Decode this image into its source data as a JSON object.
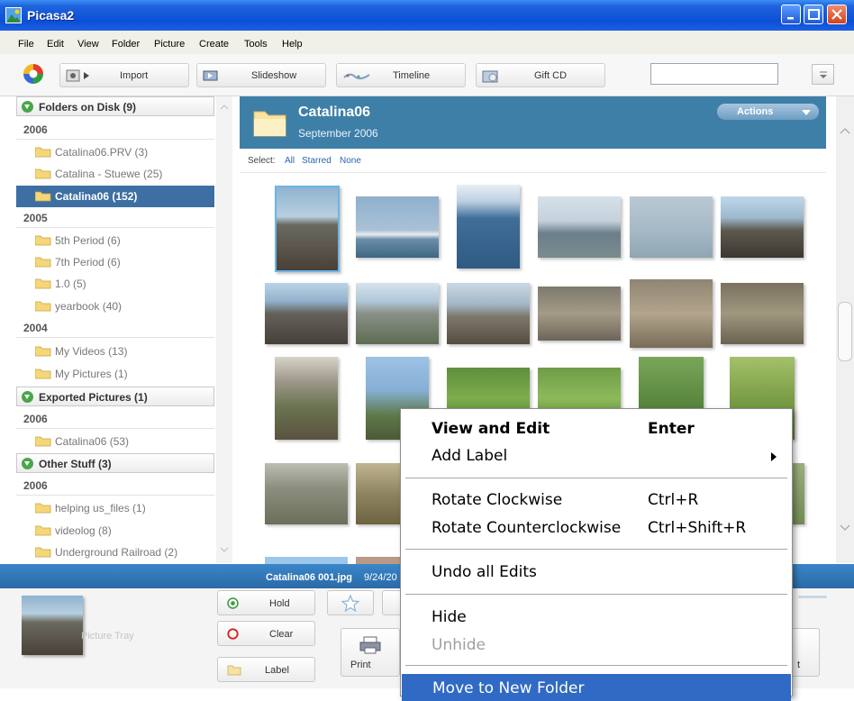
{
  "window": {
    "title": "Picasa2"
  },
  "menu": [
    "File",
    "Edit",
    "View",
    "Folder",
    "Picture",
    "Create",
    "Tools",
    "Help"
  ],
  "toolbar": {
    "import": "Import",
    "slideshow": "Slideshow",
    "timeline": "Timeline",
    "giftcd": "Gift CD",
    "search_value": ""
  },
  "sidebar": {
    "groups": [
      {
        "label": "Folders on Disk (9)"
      },
      {
        "label": "Exported Pictures (1)"
      },
      {
        "label": "Other Stuff (3)"
      }
    ],
    "years": [
      "2006",
      "2005",
      "2004",
      "2006",
      "2006"
    ],
    "folders": [
      "Catalina06.PRV (3)",
      "Catalina - Stuewe (25)",
      "Catalina06 (152)",
      "5th Period (6)",
      "7th Period (6)",
      "1.0 (5)",
      "yearbook (40)",
      "My Videos (13)",
      "My Pictures (1)",
      "Catalina06 (53)",
      "helping us_files (1)",
      "videolog (8)",
      "Underground Railroad (2)"
    ]
  },
  "album": {
    "title": "Catalina06",
    "date": "September 2006",
    "actions": "Actions",
    "select_label": "Select:",
    "select_all": "All",
    "select_starred": "Starred",
    "select_none": "None"
  },
  "status": {
    "filename": "Catalina06 001.jpg",
    "date": "9/24/20"
  },
  "tray": {
    "label": "Picture Tray",
    "hold": "Hold",
    "clear": "Clear",
    "label_btn": "Label",
    "print": "Print",
    "cut_text": "t"
  },
  "context_menu": {
    "view_edit": "View and Edit",
    "view_edit_key": "Enter",
    "add_label": "Add Label",
    "rotate_cw": "Rotate Clockwise",
    "rotate_cw_key": "Ctrl+R",
    "rotate_ccw": "Rotate Counterclockwise",
    "rotate_ccw_key": "Ctrl+Shift+R",
    "undo": "Undo all Edits",
    "hide": "Hide",
    "unhide": "Unhide",
    "move": "Move to New Folder"
  },
  "colors": {
    "title_bar": "#0b4fd6",
    "header_blue": "#3e7fa8",
    "selection": "#3d6fa3",
    "menu_highlight": "#316ac5"
  }
}
